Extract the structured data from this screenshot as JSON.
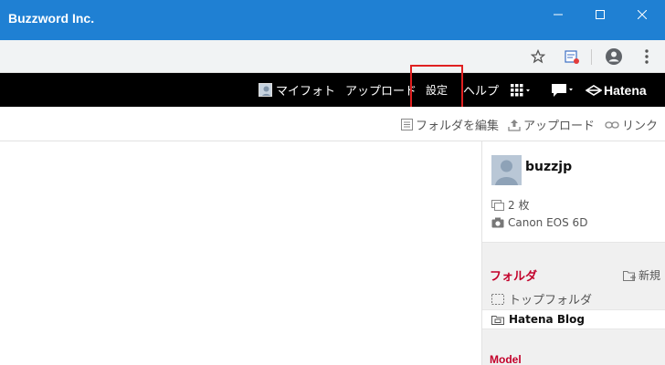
{
  "window": {
    "title": "Buzzword Inc."
  },
  "nav": {
    "myphoto": "マイフォト",
    "upload": "アップロード",
    "settings": "設定",
    "help": "ヘルプ",
    "brand": "Hatena"
  },
  "subtoolbar": {
    "edit_folder": "フォルダを編集",
    "upload": "アップロード",
    "link": "リンク"
  },
  "profile": {
    "username": "buzzjp",
    "photo_count": "2 枚",
    "camera": "Canon EOS 6D"
  },
  "folders": {
    "heading": "フォルダ",
    "new_label": "新規",
    "top_folder": "トップフォルダ",
    "items": [
      "Hatena Blog"
    ]
  },
  "model": {
    "heading": "Model"
  },
  "colors": {
    "titlebar": "#1f80d3",
    "nav": "#000000",
    "accent": "#c3002a",
    "highlight": "#e02020"
  }
}
